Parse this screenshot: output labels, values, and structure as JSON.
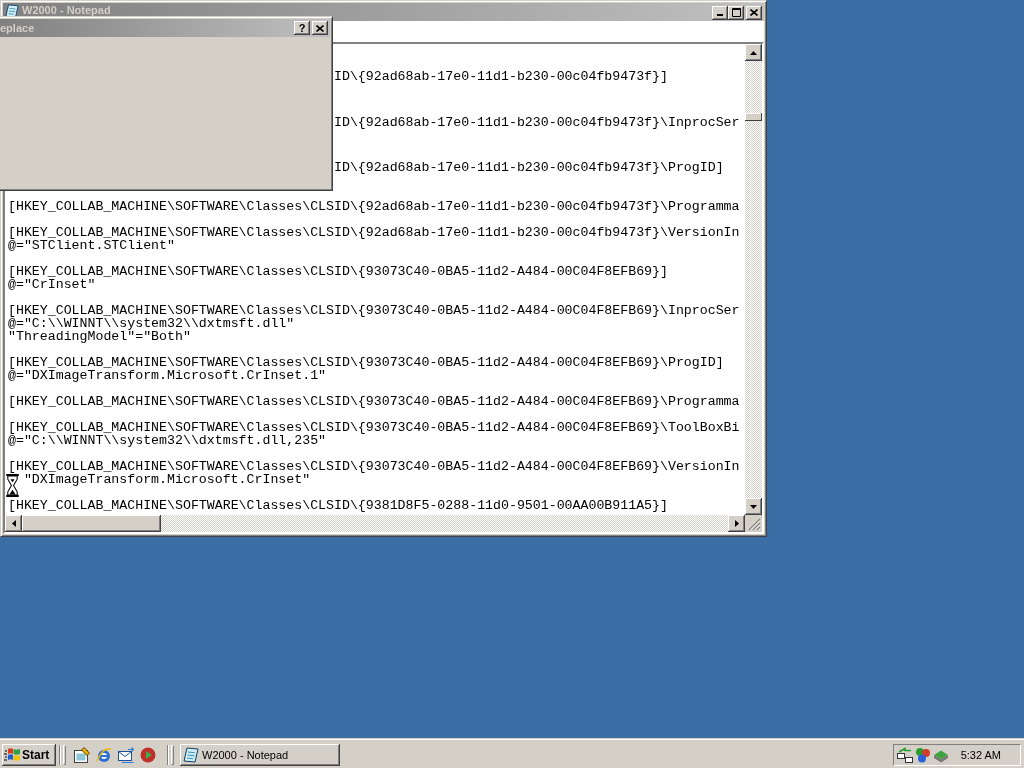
{
  "notepad": {
    "title": "W2000 - Notepad",
    "active": false
  },
  "editor": {
    "blocks": [
      {
        "kind": "tail",
        "lines": [
          {
            "text": "ID\\{92ad68ab-17e0-11d1-b230-00c04fb9473f}]"
          }
        ]
      },
      {
        "kind": "tail",
        "lines": [
          {
            "text": "ID\\{92ad68ab-17e0-11d1-b230-00c04fb9473f}\\InprocSer"
          }
        ]
      },
      {
        "kind": "tail",
        "lines": [
          {
            "text": "ID\\{92ad68ab-17e0-11d1-b230-00c04fb9473f}\\ProgID]"
          }
        ]
      },
      {
        "kind": "full",
        "lines": [
          {
            "text": "[HKEY_COLLAB_MACHINE\\SOFTWARE\\Classes\\CLSID\\{92ad68ab-17e0-11d1-b230-00c04fb9473f}\\Programma"
          }
        ]
      },
      {
        "kind": "full",
        "lines": [
          {
            "text": "[HKEY_COLLAB_MACHINE\\SOFTWARE\\Classes\\CLSID\\{92ad68ab-17e0-11d1-b230-00c04fb9473f}\\VersionIn"
          },
          {
            "text": "@=\"STClient.STClient\""
          }
        ]
      },
      {
        "kind": "full",
        "lines": [
          {
            "text": "[HKEY_COLLAB_MACHINE\\SOFTWARE\\Classes\\CLSID\\{93073C40-0BA5-11d2-A484-00C04F8EFB69}]"
          },
          {
            "text": "@=\"CrInset\""
          }
        ]
      },
      {
        "kind": "full",
        "lines": [
          {
            "text": "[HKEY_COLLAB_MACHINE\\SOFTWARE\\Classes\\CLSID\\{93073C40-0BA5-11d2-A484-00C04F8EFB69}\\InprocSer"
          },
          {
            "text": "@=\"C:\\\\WINNT\\\\system32\\\\dxtmsft.dll\""
          },
          {
            "text": "\"ThreadingModel\"=\"Both\""
          }
        ]
      },
      {
        "kind": "full",
        "lines": [
          {
            "text": "[HKEY_COLLAB_MACHINE\\SOFTWARE\\Classes\\CLSID\\{93073C40-0BA5-11d2-A484-00C04F8EFB69}\\ProgID]"
          },
          {
            "text": "@=\"DXImageTransform.Microsoft.CrInset.1\""
          }
        ]
      },
      {
        "kind": "full",
        "lines": [
          {
            "text": "[HKEY_COLLAB_MACHINE\\SOFTWARE\\Classes\\CLSID\\{93073C40-0BA5-11d2-A484-00C04F8EFB69}\\Programma"
          }
        ]
      },
      {
        "kind": "full",
        "lines": [
          {
            "text": "[HKEY_COLLAB_MACHINE\\SOFTWARE\\Classes\\CLSID\\{93073C40-0BA5-11d2-A484-00C04F8EFB69}\\ToolBoxBi"
          },
          {
            "text": "@=\"C:\\\\WINNT\\\\system32\\\\dxtmsft.dll,235\""
          }
        ]
      },
      {
        "kind": "full",
        "lines": [
          {
            "text": "[HKEY_COLLAB_MACHINE\\SOFTWARE\\Classes\\CLSID\\{93073C40-0BA5-11d2-A484-00C04F8EFB69}\\VersionIn"
          },
          {
            "text": "\"DXImageTransform.Microsoft.CrInset\"",
            "busy_cursor": true
          }
        ]
      },
      {
        "kind": "full",
        "lines": [
          {
            "text": "[HKEY_COLLAB_MACHINE\\SOFTWARE\\Classes\\CLSID\\{9381D8F5-0288-11d0-9501-00AA00B911A5}]"
          }
        ]
      }
    ]
  },
  "replace_dialog": {
    "title": "eplace",
    "active": false,
    "help_label": "?"
  },
  "taskbar": {
    "start": "Start",
    "tasks": [
      {
        "label": "W2000 - Notepad",
        "selected": false
      }
    ],
    "clock": "5:32 AM"
  }
}
